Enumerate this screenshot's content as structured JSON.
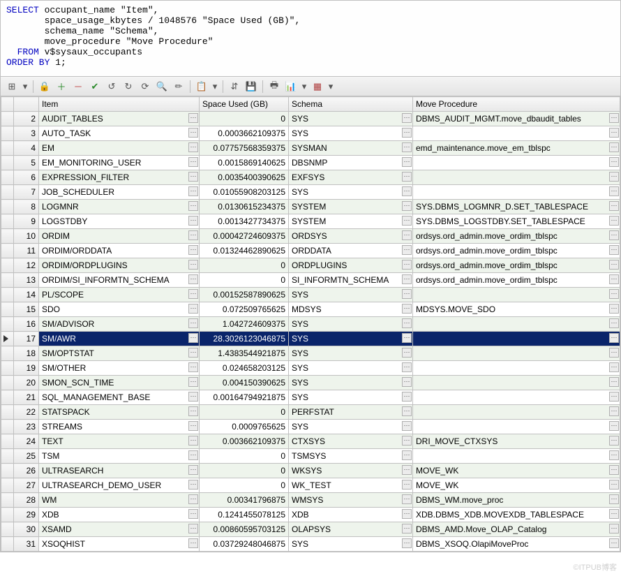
{
  "sql": {
    "line1_kw": "SELECT",
    "line1_rest": " occupant_name \"Item\",",
    "line2": "       space_usage_kbytes / 1048576 \"Space Used (GB)\",",
    "line3": "       schema_name \"Schema\",",
    "line4": "       move_procedure \"Move Procedure\"",
    "line5_kw": "  FROM",
    "line5_rest": " v$sysaux_occupants",
    "line6_kw": "ORDER BY",
    "line6_rest": " 1;"
  },
  "toolbar_icons": [
    "⊞",
    "▾",
    "🔒",
    "＋",
    "－",
    "✔",
    "↺",
    "↻",
    "⟳",
    "🔍",
    "✏",
    "📋",
    "▾",
    "⇵",
    "💾",
    "🖶",
    "📊",
    "▾",
    "▦",
    "▾"
  ],
  "columns": {
    "item": "Item",
    "space": "Space Used (GB)",
    "schema": "Schema",
    "move": "Move Procedure"
  },
  "selected_row_index": 17,
  "rows": [
    {
      "n": 2,
      "item": "AUDIT_TABLES",
      "space": "0",
      "schema": "SYS",
      "move": "DBMS_AUDIT_MGMT.move_dbaudit_tables"
    },
    {
      "n": 3,
      "item": "AUTO_TASK",
      "space": "0.0003662109375",
      "schema": "SYS",
      "move": ""
    },
    {
      "n": 4,
      "item": "EM",
      "space": "0.07757568359375",
      "schema": "SYSMAN",
      "move": "emd_maintenance.move_em_tblspc"
    },
    {
      "n": 5,
      "item": "EM_MONITORING_USER",
      "space": "0.0015869140625",
      "schema": "DBSNMP",
      "move": ""
    },
    {
      "n": 6,
      "item": "EXPRESSION_FILTER",
      "space": "0.0035400390625",
      "schema": "EXFSYS",
      "move": ""
    },
    {
      "n": 7,
      "item": "JOB_SCHEDULER",
      "space": "0.01055908203125",
      "schema": "SYS",
      "move": ""
    },
    {
      "n": 8,
      "item": "LOGMNR",
      "space": "0.0130615234375",
      "schema": "SYSTEM",
      "move": "SYS.DBMS_LOGMNR_D.SET_TABLESPACE"
    },
    {
      "n": 9,
      "item": "LOGSTDBY",
      "space": "0.0013427734375",
      "schema": "SYSTEM",
      "move": "SYS.DBMS_LOGSTDBY.SET_TABLESPACE"
    },
    {
      "n": 10,
      "item": "ORDIM",
      "space": "0.00042724609375",
      "schema": "ORDSYS",
      "move": "ordsys.ord_admin.move_ordim_tblspc"
    },
    {
      "n": 11,
      "item": "ORDIM/ORDDATA",
      "space": "0.01324462890625",
      "schema": "ORDDATA",
      "move": "ordsys.ord_admin.move_ordim_tblspc"
    },
    {
      "n": 12,
      "item": "ORDIM/ORDPLUGINS",
      "space": "0",
      "schema": "ORDPLUGINS",
      "move": "ordsys.ord_admin.move_ordim_tblspc"
    },
    {
      "n": 13,
      "item": "ORDIM/SI_INFORMTN_SCHEMA",
      "space": "0",
      "schema": "SI_INFORMTN_SCHEMA",
      "move": "ordsys.ord_admin.move_ordim_tblspc"
    },
    {
      "n": 14,
      "item": "PL/SCOPE",
      "space": "0.00152587890625",
      "schema": "SYS",
      "move": ""
    },
    {
      "n": 15,
      "item": "SDO",
      "space": "0.072509765625",
      "schema": "MDSYS",
      "move": "MDSYS.MOVE_SDO"
    },
    {
      "n": 16,
      "item": "SM/ADVISOR",
      "space": "1.042724609375",
      "schema": "SYS",
      "move": ""
    },
    {
      "n": 17,
      "item": "SM/AWR",
      "space": "28.3026123046875",
      "schema": "SYS",
      "move": ""
    },
    {
      "n": 18,
      "item": "SM/OPTSTAT",
      "space": "1.4383544921875",
      "schema": "SYS",
      "move": ""
    },
    {
      "n": 19,
      "item": "SM/OTHER",
      "space": "0.024658203125",
      "schema": "SYS",
      "move": ""
    },
    {
      "n": 20,
      "item": "SMON_SCN_TIME",
      "space": "0.004150390625",
      "schema": "SYS",
      "move": ""
    },
    {
      "n": 21,
      "item": "SQL_MANAGEMENT_BASE",
      "space": "0.00164794921875",
      "schema": "SYS",
      "move": ""
    },
    {
      "n": 22,
      "item": "STATSPACK",
      "space": "0",
      "schema": "PERFSTAT",
      "move": ""
    },
    {
      "n": 23,
      "item": "STREAMS",
      "space": "0.0009765625",
      "schema": "SYS",
      "move": ""
    },
    {
      "n": 24,
      "item": "TEXT",
      "space": "0.003662109375",
      "schema": "CTXSYS",
      "move": "DRI_MOVE_CTXSYS"
    },
    {
      "n": 25,
      "item": "TSM",
      "space": "0",
      "schema": "TSMSYS",
      "move": ""
    },
    {
      "n": 26,
      "item": "ULTRASEARCH",
      "space": "0",
      "schema": "WKSYS",
      "move": "MOVE_WK"
    },
    {
      "n": 27,
      "item": "ULTRASEARCH_DEMO_USER",
      "space": "0",
      "schema": "WK_TEST",
      "move": "MOVE_WK"
    },
    {
      "n": 28,
      "item": "WM",
      "space": "0.00341796875",
      "schema": "WMSYS",
      "move": "DBMS_WM.move_proc"
    },
    {
      "n": 29,
      "item": "XDB",
      "space": "0.1241455078125",
      "schema": "XDB",
      "move": "XDB.DBMS_XDB.MOVEXDB_TABLESPACE"
    },
    {
      "n": 30,
      "item": "XSAMD",
      "space": "0.00860595703125",
      "schema": "OLAPSYS",
      "move": "DBMS_AMD.Move_OLAP_Catalog"
    },
    {
      "n": 31,
      "item": "XSOQHIST",
      "space": "0.03729248046875",
      "schema": "SYS",
      "move": "DBMS_XSOQ.OlapiMoveProc"
    }
  ],
  "watermark": "©ITPUB博客"
}
